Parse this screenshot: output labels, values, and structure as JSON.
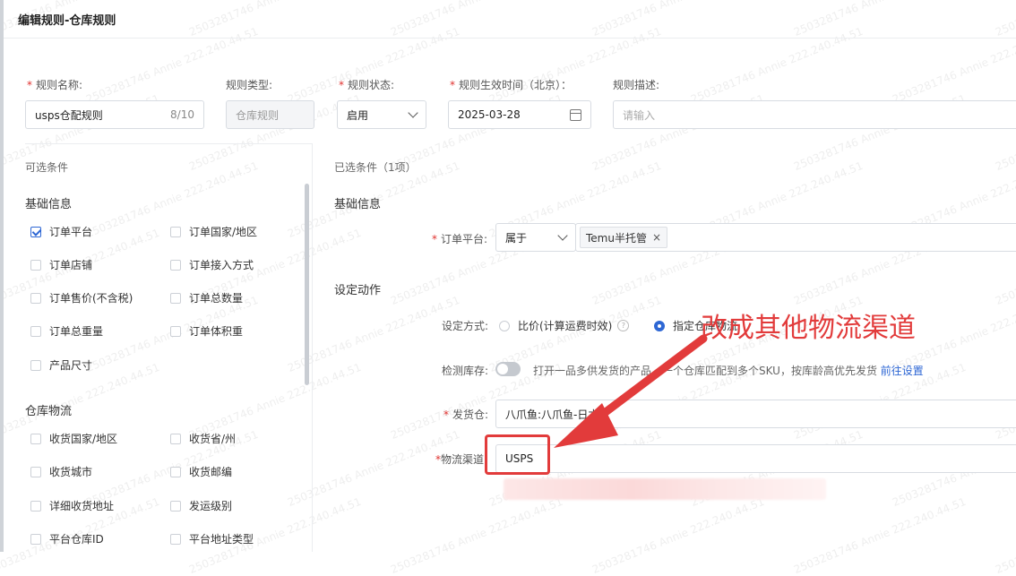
{
  "page_title": "编辑规则-仓库规则",
  "form": {
    "rule_name": {
      "label": "规则名称:",
      "value": "usps仓配规则",
      "counter": "8/10"
    },
    "rule_type": {
      "label": "规则类型:",
      "value": "仓库规则"
    },
    "rule_status": {
      "label": "规则状态:",
      "value": "启用"
    },
    "effective_time": {
      "label": "规则生效时间（北京）：",
      "value": "2025-03-28"
    },
    "description": {
      "label": "规则描述:",
      "placeholder": "请输入"
    }
  },
  "left_panel": {
    "title": "可选条件",
    "groups": [
      {
        "heading": "基础信息",
        "items": [
          {
            "label": "订单平台",
            "checked": true
          },
          {
            "label": "订单国家/地区",
            "checked": false
          },
          {
            "label": "订单店铺",
            "checked": false
          },
          {
            "label": "订单接入方式",
            "checked": false
          },
          {
            "label": "订单售价(不含税)",
            "checked": false
          },
          {
            "label": "订单总数量",
            "checked": false
          },
          {
            "label": "订单总重量",
            "checked": false
          },
          {
            "label": "订单体积重",
            "checked": false
          },
          {
            "label": "产品尺寸",
            "checked": false
          }
        ]
      },
      {
        "heading": "仓库物流",
        "items": [
          {
            "label": "收货国家/地区",
            "checked": false
          },
          {
            "label": "收货省/州",
            "checked": false
          },
          {
            "label": "收货城市",
            "checked": false
          },
          {
            "label": "收货邮编",
            "checked": false
          },
          {
            "label": "详细收货地址",
            "checked": false
          },
          {
            "label": "发运级别",
            "checked": false
          },
          {
            "label": "平台仓库ID",
            "checked": false
          },
          {
            "label": "平台地址类型",
            "checked": false
          }
        ]
      }
    ]
  },
  "right_panel": {
    "title": "已选条件（1项）",
    "basic_heading": "基础信息",
    "order_platform": {
      "label": "订单平台:",
      "operator": "属于",
      "tag": "Temu半托管",
      "tag_close": "×"
    },
    "action_heading": "设定动作",
    "method": {
      "label": "设定方式:",
      "option_a": "比价(计算运费时效)",
      "option_b": "指定仓库物流"
    },
    "stock_check": {
      "label": "检测库存:",
      "hint": "打开一品多供发货的产品，一个仓库匹配到多个SKU，按库龄高优先发货",
      "link": "前往设置"
    },
    "warehouse": {
      "label": "发货仓:",
      "value": "八爪鱼:八爪鱼-日本仓"
    },
    "channel": {
      "label": "物流渠道",
      "value": "USPS"
    }
  },
  "annotation": {
    "text": "改成其他物流渠道",
    "color": "#e23b3b"
  },
  "watermark": "2503281746 Annie 222.240.44.51",
  "colors": {
    "accent": "#2e67d4",
    "required": "#e0322f"
  }
}
